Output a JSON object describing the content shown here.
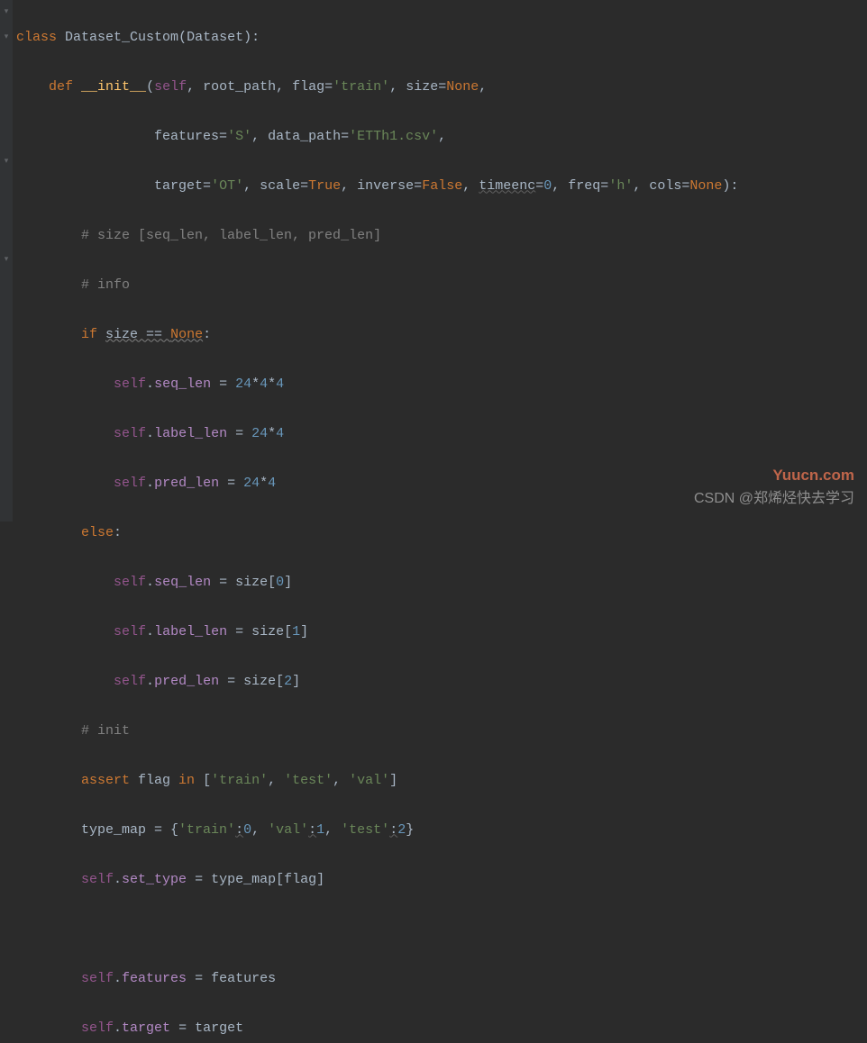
{
  "code": {
    "class_kw": "class",
    "class_name": "Dataset_Custom",
    "base_class": "Dataset",
    "def_kw": "def",
    "init_name": "__init__",
    "p_self": "self",
    "p_root_path": "root_path",
    "p_flag": "flag",
    "p_flag_val": "'train'",
    "p_size": "size",
    "p_size_val": "None",
    "p_features": "features",
    "p_features_val": "'S'",
    "p_data_path": "data_path",
    "p_data_path_val": "'ETTh1.csv'",
    "p_target": "target",
    "p_target_val": "'OT'",
    "p_scale": "scale",
    "p_scale_val": "True",
    "p_inverse": "inverse",
    "p_inverse_val": "False",
    "p_timeenc": "timeenc",
    "p_timeenc_val": "0",
    "p_freq": "freq",
    "p_freq_val": "'h'",
    "p_cols": "cols",
    "p_cols_val": "None",
    "c_size": "# size [seq_len, label_len, pred_len]",
    "c_info": "# info",
    "if_kw": "if",
    "none_kw": "None",
    "eq_op": " == ",
    "else_kw": "else",
    "seq_len": "seq_len",
    "label_len": "label_len",
    "pred_len": "pred_len",
    "n24": "24",
    "n4": "4",
    "n0": "0",
    "n1": "1",
    "n2": "2",
    "c_init": "# init",
    "assert_kw": "assert",
    "in_kw": "in",
    "s_train": "'train'",
    "s_test": "'test'",
    "s_val": "'val'",
    "type_map": "type_map",
    "set_type": "set_type",
    "features_attr": "features",
    "target_attr": "target"
  },
  "watermark": {
    "top": "Yuucn.com",
    "bottom": "CSDN @郑烯烃快去学习"
  }
}
